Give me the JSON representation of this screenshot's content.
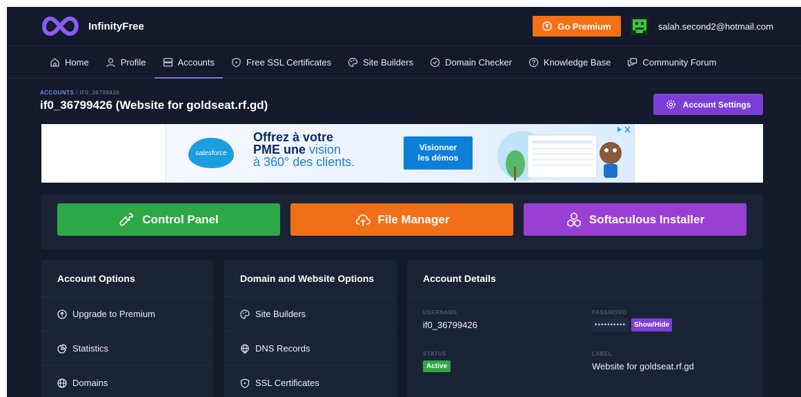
{
  "brand": {
    "name": "InfinityFree"
  },
  "topbar": {
    "premium_label": "Go Premium",
    "user_email": "salah.second2@hotmail.com"
  },
  "nav": {
    "items": [
      {
        "label": "Home",
        "icon": "home-icon"
      },
      {
        "label": "Profile",
        "icon": "user-icon"
      },
      {
        "label": "Accounts",
        "icon": "server-icon",
        "active": true
      },
      {
        "label": "Free SSL Certificates",
        "icon": "shield-icon"
      },
      {
        "label": "Site Builders",
        "icon": "palette-icon"
      },
      {
        "label": "Domain Checker",
        "icon": "check-circle-icon"
      },
      {
        "label": "Knowledge Base",
        "icon": "help-circle-icon"
      },
      {
        "label": "Community Forum",
        "icon": "chat-icon"
      }
    ]
  },
  "header": {
    "breadcrumb_root": "ACCOUNTS",
    "breadcrumb_sep": "/",
    "breadcrumb_current": "IF0_36799426",
    "title": "if0_36799426 (Website for goldseat.rf.gd)",
    "settings_label": "Account Settings"
  },
  "ad": {
    "logo_text": "salesforce",
    "line1": "Offrez à votre",
    "line2a": "PME une ",
    "line2b": "vision",
    "line3": "à 360° des clients.",
    "cta_line1": "Visionner",
    "cta_line2": "les démos"
  },
  "actions": {
    "control_panel": "Control Panel",
    "file_manager": "File Manager",
    "softaculous": "Softaculous Installer"
  },
  "account_options": {
    "title": "Account Options",
    "items": [
      "Upgrade to Premium",
      "Statistics",
      "Domains"
    ]
  },
  "domain_options": {
    "title": "Domain and Website Options",
    "items": [
      "Site Builders",
      "DNS Records",
      "SSL Certificates"
    ]
  },
  "account_details": {
    "title": "Account Details",
    "username_label": "USERNAME",
    "username": "if0_36799426",
    "password_label": "PASSWORD",
    "password_mask": "••••••••••",
    "showhide_label": "Show/Hide",
    "status_label": "STATUS",
    "status": "Active",
    "label_label": "LABEL",
    "label": "Website for goldseat.rf.gd"
  },
  "colors": {
    "background": "#121a2b",
    "panel": "#1a2336",
    "accent_purple": "#7c3fd6",
    "orange": "#f0701a",
    "green": "#2ea846"
  }
}
